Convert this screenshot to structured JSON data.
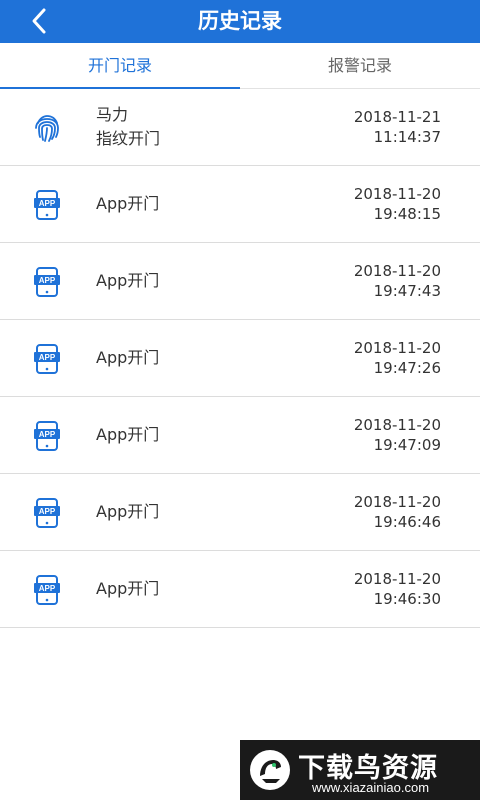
{
  "header": {
    "title": "历史记录",
    "back_icon": "chevron-left-icon"
  },
  "tabs": [
    {
      "label": "开门记录",
      "active": true
    },
    {
      "label": "报警记录",
      "active": false
    }
  ],
  "records": [
    {
      "icon": "fingerprint-icon",
      "name": "马力",
      "method": "指纹开门",
      "date": "2018-11-21",
      "time": "11:14:37"
    },
    {
      "icon": "app-phone-icon",
      "name": "",
      "method": "App开门",
      "date": "2018-11-20",
      "time": "19:48:15"
    },
    {
      "icon": "app-phone-icon",
      "name": "",
      "method": "App开门",
      "date": "2018-11-20",
      "time": "19:47:43"
    },
    {
      "icon": "app-phone-icon",
      "name": "",
      "method": "App开门",
      "date": "2018-11-20",
      "time": "19:47:26"
    },
    {
      "icon": "app-phone-icon",
      "name": "",
      "method": "App开门",
      "date": "2018-11-20",
      "time": "19:47:09"
    },
    {
      "icon": "app-phone-icon",
      "name": "",
      "method": "App开门",
      "date": "2018-11-20",
      "time": "19:46:46"
    },
    {
      "icon": "app-phone-icon",
      "name": "",
      "method": "App开门",
      "date": "2018-11-20",
      "time": "19:46:30"
    }
  ],
  "watermark": {
    "brand": "下载鸟资源",
    "url": "www.xiazainiao.com"
  },
  "colors": {
    "primary": "#1f72d8",
    "text": "#333333",
    "divider": "#dcdcdc"
  }
}
